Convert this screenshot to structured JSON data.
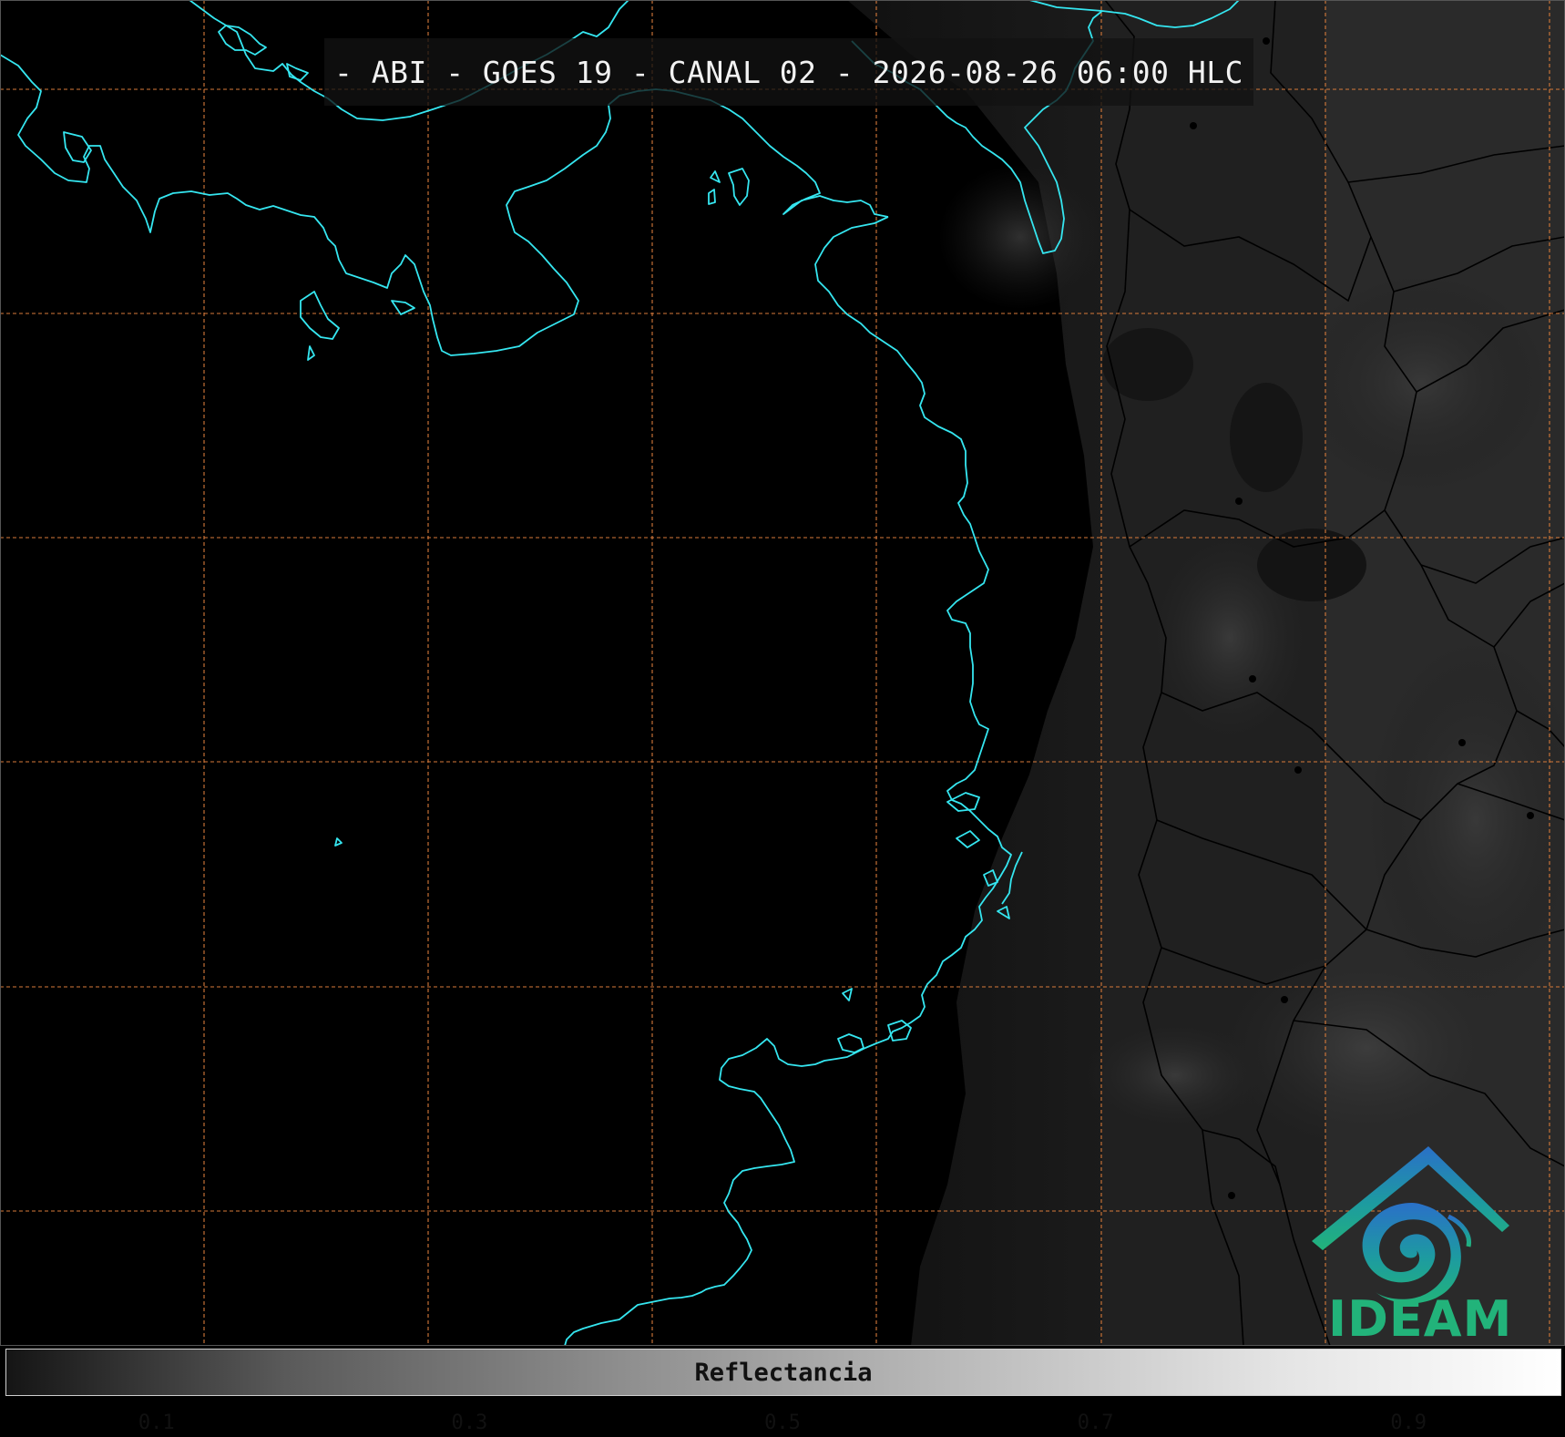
{
  "title": "- ABI - GOES 19 - CANAL 02 - 2026-08-26 06:00 HLC",
  "colorbar": {
    "label": "Reflectancia",
    "min": 0.0,
    "max": 1.0,
    "major_ticks": [
      0.1,
      0.3,
      0.5,
      0.7,
      0.9
    ],
    "major_tick_labels": [
      "0.1",
      "0.3",
      "0.5",
      "0.7",
      "0.9"
    ],
    "minor_tick_step": 0.05
  },
  "logo": {
    "name": "IDEAM",
    "icon": "ideam-logo-icon"
  },
  "map": {
    "coastline_color": "#35e6f0",
    "grid_color": "#d77a3a",
    "land_border_color": "#000000",
    "graticule": "dashed"
  }
}
